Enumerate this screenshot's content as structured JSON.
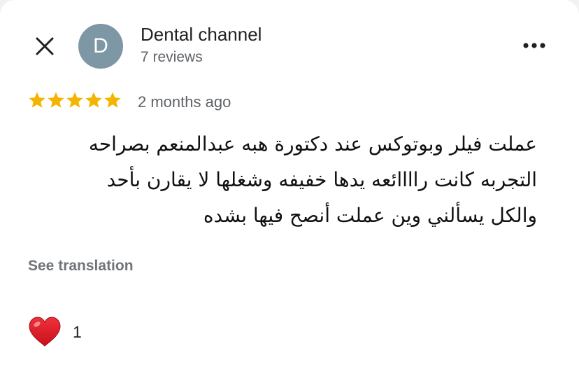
{
  "reviewer": {
    "avatar_letter": "D",
    "name": "Dental channel",
    "review_count": "7 reviews",
    "avatar_color": "#7e97a5"
  },
  "review": {
    "rating": 5,
    "max_rating": 5,
    "time_ago": "2 months ago",
    "text_lines": [
      "عملت فيلر وبوتوكس عند دكتورة هبه عبدالمنعم بصراحه",
      "التجربه كانت راااائعه يدها خفيفه وشغلها لا يقارن بأحد",
      "والكل يسألني وين عملت أنصح فيها بشده"
    ],
    "see_translation": "See translation",
    "star_color": "#f4b400"
  },
  "reactions": {
    "icon": "heart-icon",
    "count": "1"
  },
  "toolbar": {
    "close_icon": "close-icon",
    "more_icon": "more-horizontal-icon"
  }
}
